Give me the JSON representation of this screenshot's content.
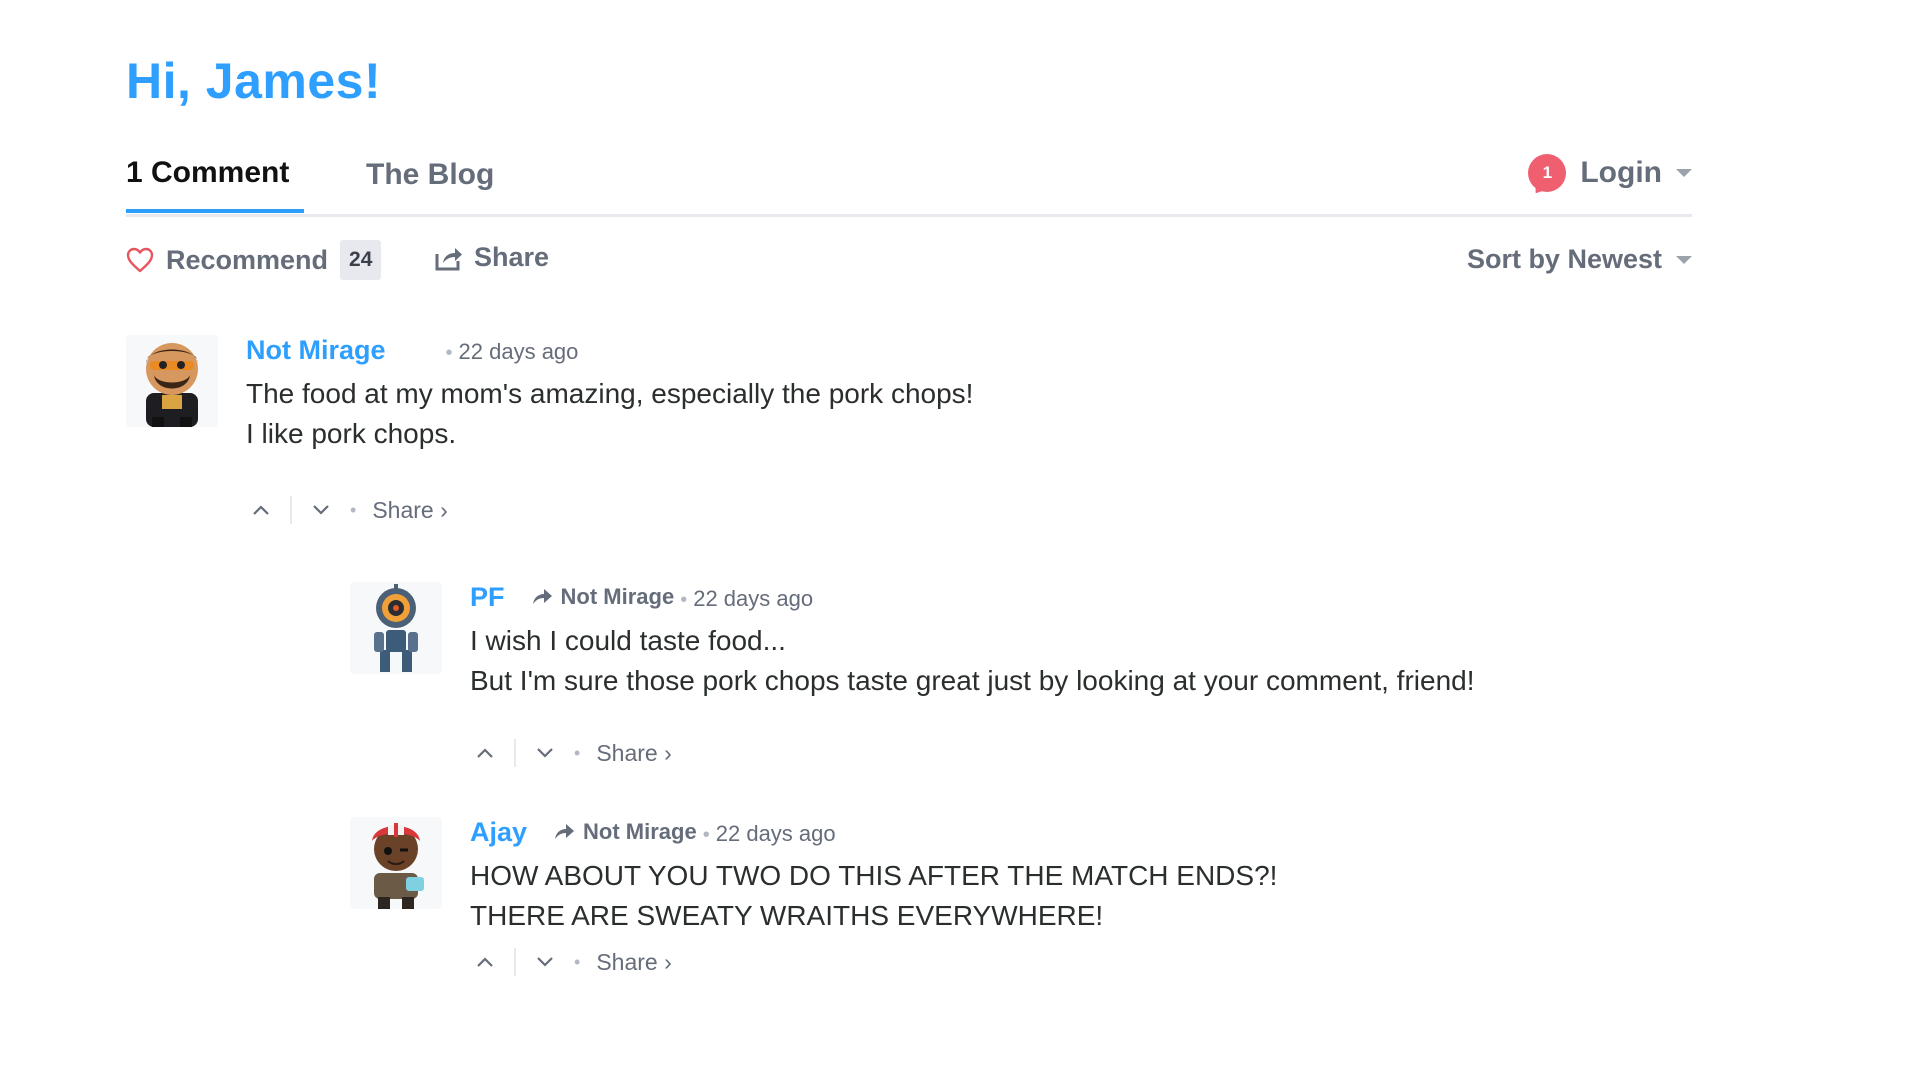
{
  "greeting": "Hi, James!",
  "tabs": {
    "comments_label": "1 Comment",
    "blog_label": "The Blog"
  },
  "login": {
    "notification_count": "1",
    "label": "Login"
  },
  "actions": {
    "recommend_label": "Recommend",
    "recommend_count": "24",
    "share_label": "Share",
    "sort_label": "Sort by Newest"
  },
  "comments": [
    {
      "author": "Not Mirage",
      "reply_to": "",
      "time": "22 days ago",
      "lines": [
        "The food at my mom's amazing, especially the pork chops!",
        "I like pork chops."
      ],
      "share_label": "Share ›",
      "avatar_icon": "mirage-avatar"
    },
    {
      "author": "PF",
      "reply_to": "Not Mirage",
      "time": "22 days ago",
      "lines": [
        "I wish I could taste food...",
        "But I'm sure those pork chops taste great just by looking at your comment, friend!"
      ],
      "share_label": "Share ›",
      "avatar_icon": "pathfinder-avatar"
    },
    {
      "author": "Ajay",
      "reply_to": "Not Mirage",
      "time": "22 days ago",
      "lines": [
        "HOW ABOUT YOU TWO DO THIS AFTER THE MATCH ENDS?!",
        "THERE ARE SWEATY WRAITHS EVERYWHERE!"
      ],
      "share_label": "Share ›",
      "avatar_icon": "lifeline-avatar"
    }
  ],
  "colors": {
    "accent": "#2e9fff",
    "muted": "#656c7a",
    "badge": "#f05f70",
    "divider": "#e7e9ee"
  }
}
